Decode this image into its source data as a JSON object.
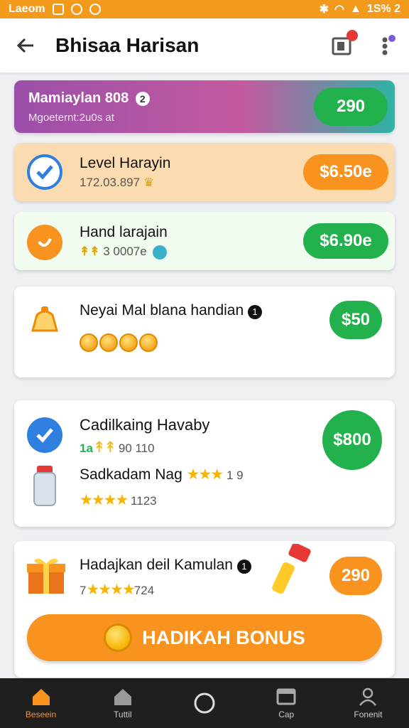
{
  "status": {
    "carrier": "Laeom",
    "battery": "1S% 2"
  },
  "header": {
    "title": "Bhisaa Harisan"
  },
  "cards": [
    {
      "title": "Mamiaylan 808",
      "subtitle": "Mgoeternt:2u0s at",
      "value": "290",
      "pill_color": "#22b14c"
    },
    {
      "title": "Level Harayin",
      "subtitle": "172.03.897",
      "value": "$6.50e",
      "pill_color": "#f7931e"
    },
    {
      "title": "Hand larajain",
      "subtitle": "3 0007e",
      "value": "$6.90e",
      "pill_color": "#22b14c"
    },
    {
      "title": "Neyai Mal blana handian",
      "value": "$50",
      "pill_color": "#22b14c"
    },
    {
      "title": "Cadilkaing Havaby",
      "subtitle": "90 110",
      "prefix": "1a",
      "value": "$800",
      "title2": "Sadkadam Nag",
      "rating2": "1 9",
      "rating3": "1123",
      "pill_color": "#22b14c"
    },
    {
      "title": "Hadajkan deil Kamulan",
      "rating_prefix": "7",
      "rating": "724",
      "value": "290",
      "pill_color": "#f7931e"
    }
  ],
  "bonus_button": {
    "label": "HADIKAH BONUS"
  },
  "nav": [
    {
      "label": "Beseein",
      "icon": "home-icon"
    },
    {
      "label": "Tuttil",
      "icon": "store-icon"
    },
    {
      "label": "",
      "icon": "circle-icon"
    },
    {
      "label": "Cap",
      "icon": "window-icon"
    },
    {
      "label": "Fonenit",
      "icon": "person-icon"
    }
  ]
}
